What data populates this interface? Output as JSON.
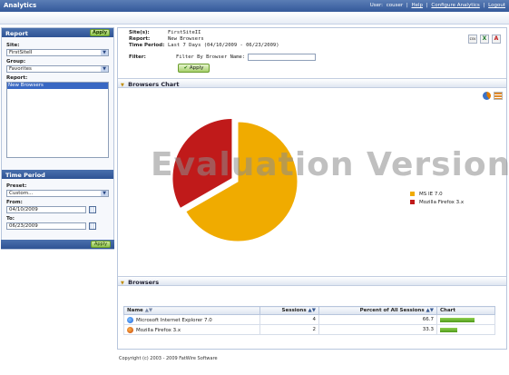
{
  "app": {
    "title": "Analytics"
  },
  "topbar": {
    "user_prefix": "User:",
    "user_name": "couser",
    "sep1": "|",
    "help": "Help",
    "sep2": "|",
    "configure": "Configure Analytics",
    "sep3": "|",
    "logout": "Logout"
  },
  "report_panel": {
    "title": "Report",
    "apply": "Apply",
    "site_label": "Site:",
    "site_value": "FirstSiteII",
    "group_label": "Group:",
    "group_value": "Favorites",
    "report_label": "Report:",
    "report_selected": "New Browsers"
  },
  "time_panel": {
    "title": "Time Period",
    "preset_label": "Preset:",
    "preset_value": "Custom...",
    "from_label": "From:",
    "from_value": "04/10/2009",
    "to_label": "To:",
    "to_value": "06/23/2009",
    "apply": "Apply"
  },
  "summary": {
    "site_k": "Site(s):",
    "site_v": "FirstSiteII",
    "report_k": "Report:",
    "report_v": "New Browsers",
    "period_k": "Time Period:",
    "period_v": "Last 7 Days (04/10/2009 - 06/23/2009)",
    "filter_k": "Filter:",
    "filter_v": "Filter By Browser Name:",
    "apply": "Apply"
  },
  "exports": {
    "csv": "csv",
    "xls": "X",
    "pdf": "A"
  },
  "chart_section": {
    "title": "Browsers Chart",
    "watermark": "Evaluation Version"
  },
  "chart_data": {
    "type": "pie",
    "categories": [
      "MS IE 7.0",
      "Mozilla Firefox 3.x"
    ],
    "values": [
      66.7,
      33.3
    ],
    "colors": [
      "#f0ab00",
      "#c01a1a"
    ]
  },
  "table_section": {
    "title": "Browsers"
  },
  "table": {
    "headers": [
      "Name",
      "Sessions",
      "Percent of All Sessions",
      "Chart"
    ],
    "rows": [
      {
        "name": "Microsoft Internet Explorer 7.0",
        "sessions": "4",
        "percent": "66.7",
        "fraction": 0.667,
        "icon": "ie-icon"
      },
      {
        "name": "Mozilla Firefox 3.x",
        "sessions": "2",
        "percent": "33.3",
        "fraction": 0.333,
        "icon": "firefox-icon"
      }
    ]
  },
  "footer": "Copyright (c) 2003 - 2009 FatWire Software"
}
